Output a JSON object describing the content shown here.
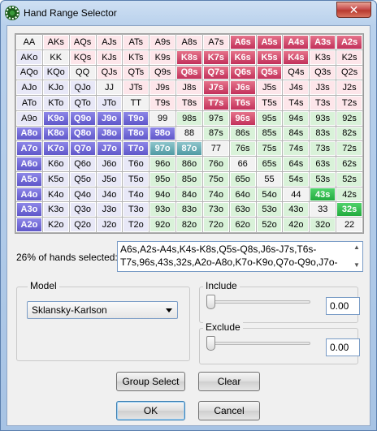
{
  "window": {
    "title": "Hand Range Selector",
    "close_label": "✕"
  },
  "grid": {
    "rows": [
      [
        "AA",
        "AKs",
        "AQs",
        "AJs",
        "ATs",
        "A9s",
        "A8s",
        "A7s",
        "A6s",
        "A5s",
        "A4s",
        "A3s",
        "A2s"
      ],
      [
        "AKo",
        "KK",
        "KQs",
        "KJs",
        "KTs",
        "K9s",
        "K8s",
        "K7s",
        "K6s",
        "K5s",
        "K4s",
        "K3s",
        "K2s"
      ],
      [
        "AQo",
        "KQo",
        "QQ",
        "QJs",
        "QTs",
        "Q9s",
        "Q8s",
        "Q7s",
        "Q6s",
        "Q5s",
        "Q4s",
        "Q3s",
        "Q2s"
      ],
      [
        "AJo",
        "KJo",
        "QJo",
        "JJ",
        "JTs",
        "J9s",
        "J8s",
        "J7s",
        "J6s",
        "J5s",
        "J4s",
        "J3s",
        "J2s"
      ],
      [
        "ATo",
        "KTo",
        "QTo",
        "JTo",
        "TT",
        "T9s",
        "T8s",
        "T7s",
        "T6s",
        "T5s",
        "T4s",
        "T3s",
        "T2s"
      ],
      [
        "A9o",
        "K9o",
        "Q9o",
        "J9o",
        "T9o",
        "99",
        "98s",
        "97s",
        "96s",
        "95s",
        "94s",
        "93s",
        "92s"
      ],
      [
        "A8o",
        "K8o",
        "Q8o",
        "J8o",
        "T8o",
        "98o",
        "88",
        "87s",
        "86s",
        "85s",
        "84s",
        "83s",
        "82s"
      ],
      [
        "A7o",
        "K7o",
        "Q7o",
        "J7o",
        "T7o",
        "97o",
        "87o",
        "77",
        "76s",
        "75s",
        "74s",
        "73s",
        "72s"
      ],
      [
        "A6o",
        "K6o",
        "Q6o",
        "J6o",
        "T6o",
        "96o",
        "86o",
        "76o",
        "66",
        "65s",
        "64s",
        "63s",
        "62s"
      ],
      [
        "A5o",
        "K5o",
        "Q5o",
        "J5o",
        "T5o",
        "95o",
        "85o",
        "75o",
        "65o",
        "55",
        "54s",
        "53s",
        "52s"
      ],
      [
        "A4o",
        "K4o",
        "Q4o",
        "J4o",
        "T4o",
        "94o",
        "84o",
        "74o",
        "64o",
        "54o",
        "44",
        "43s",
        "42s"
      ],
      [
        "A3o",
        "K3o",
        "Q3o",
        "J3o",
        "T3o",
        "93o",
        "83o",
        "73o",
        "63o",
        "53o",
        "43o",
        "33",
        "32s"
      ],
      [
        "A2o",
        "K2o",
        "Q2o",
        "J2o",
        "T2o",
        "92o",
        "82o",
        "72o",
        "62o",
        "52o",
        "42o",
        "32o",
        "22"
      ]
    ],
    "selected": [
      "A6s",
      "A5s",
      "A4s",
      "A3s",
      "A2s",
      "K8s",
      "K7s",
      "K6s",
      "K5s",
      "K4s",
      "Q8s",
      "Q7s",
      "Q6s",
      "Q5s",
      "J7s",
      "J6s",
      "T7s",
      "T6s",
      "96s",
      "43s",
      "32s",
      "A8o",
      "A7o",
      "A6o",
      "A5o",
      "A4o",
      "A3o",
      "A2o",
      "K9o",
      "K8o",
      "K7o",
      "Q9o",
      "Q8o",
      "Q7o",
      "J9o",
      "J8o",
      "J7o",
      "T9o",
      "T8o",
      "T7o",
      "98o",
      "97o",
      "87o"
    ],
    "colors": {
      "suited_selected": "#c2315b",
      "offsuit_selected": "#5f57c9",
      "teal_selected": "#4f9aa3",
      "green_selected": "#23ab3f",
      "pair_bg": "#f2f2f2",
      "suited_bg": "#fde6ea",
      "offsuit_bg": "#e8e8f7",
      "lower_bg": "#d9f2d9"
    }
  },
  "selection": {
    "label": "26% of hands selected:",
    "text": "A6s,A2s-A4s,K4s-K8s,Q5s-Q8s,J6s-J7s,T6s-T7s,96s,43s,32s,A2o-A8o,K7o-K9o,Q7o-Q9o,J7o-"
  },
  "model": {
    "label": "Model",
    "selected": "Sklansky-Karlson"
  },
  "include": {
    "label": "Include",
    "value": "0.00",
    "level": 0.0
  },
  "exclude": {
    "label": "Exclude",
    "value": "0.00",
    "level": 0.0
  },
  "buttons": {
    "group_select": "Group Select",
    "clear": "Clear",
    "ok": "OK",
    "cancel": "Cancel"
  }
}
